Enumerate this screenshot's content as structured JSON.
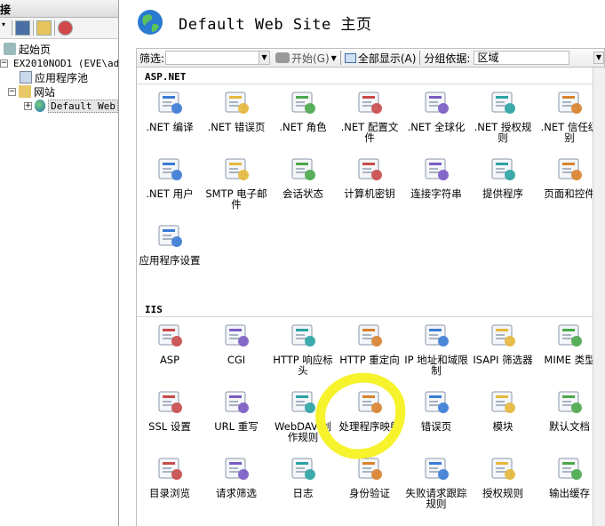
{
  "left": {
    "header": "接",
    "tree": [
      {
        "label": "起始页"
      },
      {
        "label": "EX2010NOD1 (EVE\\ad"
      },
      {
        "label": "应用程序池"
      },
      {
        "label": "网站"
      },
      {
        "label": "Default Web"
      }
    ]
  },
  "main": {
    "title": "Default Web Site 主页",
    "filter": {
      "label": "筛选:",
      "start": "开始(G)",
      "showall": "全部显示(A)",
      "groupby_label": "分组依据:",
      "groupby_value": "区域"
    },
    "sections": [
      {
        "title": "ASP.NET",
        "items": [
          {
            "label": ".NET 编译",
            "icon": "dotnet-compile-icon"
          },
          {
            "label": ".NET 错误页",
            "icon": "error-page-404-icon"
          },
          {
            "label": ".NET 角色",
            "icon": "roles-icon"
          },
          {
            "label": ".NET 配置文件",
            "icon": "profile-icon"
          },
          {
            "label": ".NET 全球化",
            "icon": "globe-icon"
          },
          {
            "label": ".NET 授权规则",
            "icon": "lock-icon"
          },
          {
            "label": ".NET 信任级别",
            "icon": "trust-level-icon"
          },
          {
            "label": ".NET 用户",
            "icon": "user-icon"
          },
          {
            "label": "SMTP 电子邮件",
            "icon": "email-icon"
          },
          {
            "label": "会话状态",
            "icon": "session-state-icon"
          },
          {
            "label": "计算机密钥",
            "icon": "machine-key-icon"
          },
          {
            "label": "连接字符串",
            "icon": "connection-string-icon"
          },
          {
            "label": "提供程序",
            "icon": "provider-icon"
          },
          {
            "label": "页面和控件",
            "icon": "pages-controls-icon"
          },
          {
            "label": "应用程序设置",
            "icon": "app-settings-icon"
          }
        ]
      },
      {
        "title": "IIS",
        "items": [
          {
            "label": "ASP",
            "icon": "asp-icon"
          },
          {
            "label": "CGI",
            "icon": "cgi-icon"
          },
          {
            "label": "HTTP 响应标头",
            "icon": "http-header-icon"
          },
          {
            "label": "HTTP 重定向",
            "icon": "redirect-icon"
          },
          {
            "label": "IP 地址和域限制",
            "icon": "ip-restrict-icon"
          },
          {
            "label": "ISAPI 筛选器",
            "icon": "isapi-filter-icon"
          },
          {
            "label": "MIME 类型",
            "icon": "mime-icon"
          },
          {
            "label": "SSL 设置",
            "icon": "ssl-lock-icon"
          },
          {
            "label": "URL 重写",
            "icon": "url-rewrite-icon"
          },
          {
            "label": "WebDAV 创作规则",
            "icon": "webdav-icon"
          },
          {
            "label": "处理程序映射",
            "icon": "handler-mapping-icon"
          },
          {
            "label": "错误页",
            "icon": "error-page-icon"
          },
          {
            "label": "模块",
            "icon": "modules-icon"
          },
          {
            "label": "默认文档",
            "icon": "default-document-icon"
          },
          {
            "label": "目录浏览",
            "icon": "directory-browsing-icon"
          },
          {
            "label": "请求筛选",
            "icon": "request-filter-icon"
          },
          {
            "label": "日志",
            "icon": "logging-icon"
          },
          {
            "label": "身份验证",
            "icon": "authentication-icon"
          },
          {
            "label": "失败请求跟踪规则",
            "icon": "failed-request-icon"
          },
          {
            "label": "授权规则",
            "icon": "authorization-icon"
          },
          {
            "label": "输出缓存",
            "icon": "output-cache-icon"
          }
        ]
      }
    ]
  },
  "colors": {
    "highlight": "#f6f22b",
    "accent": "#2b6cc4"
  }
}
